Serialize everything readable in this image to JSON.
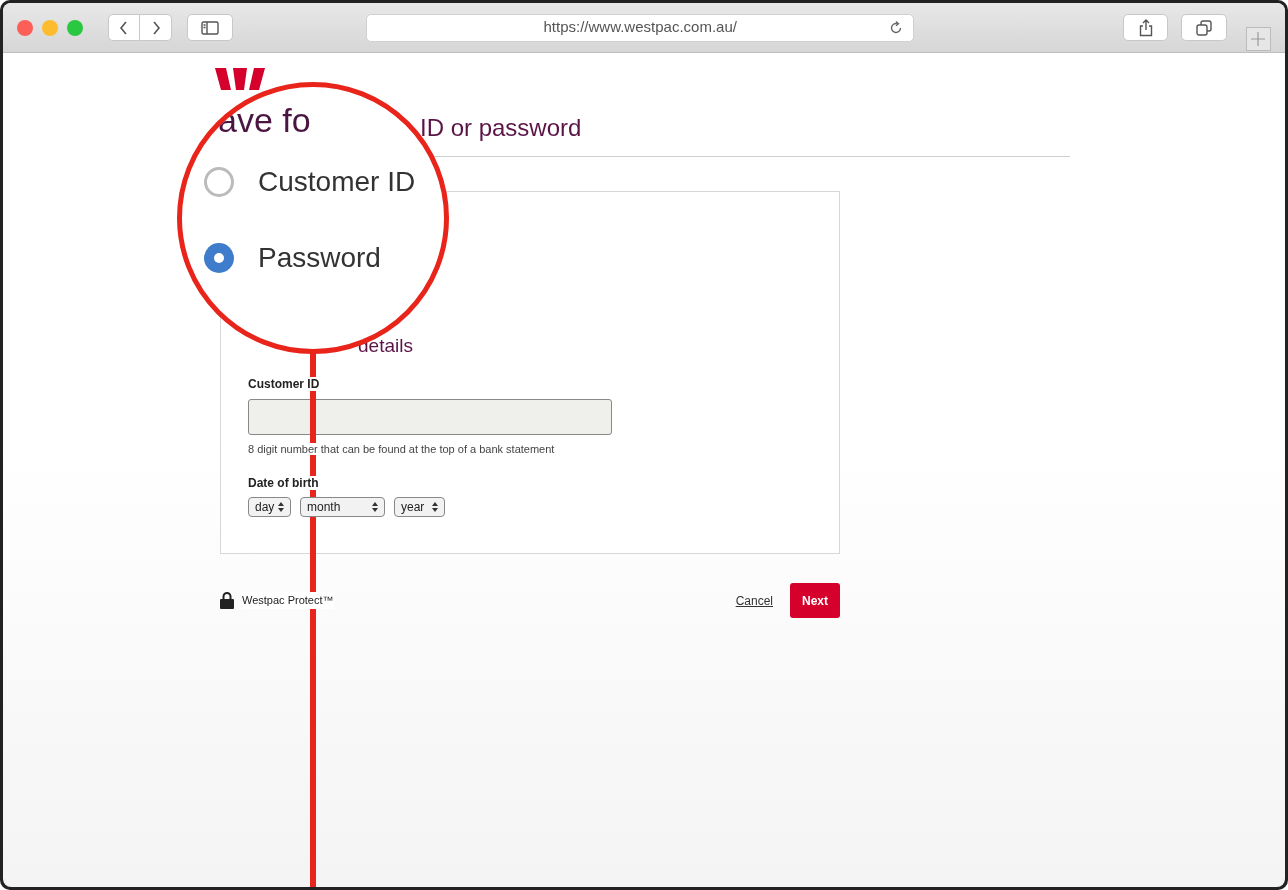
{
  "browser": {
    "url": "https://www.westpac.com.au/"
  },
  "page": {
    "heading": "ID or password",
    "subheading": "details",
    "customer_id": {
      "label": "Customer ID",
      "hint": "8 digit number that can be found at the top of a bank statement"
    },
    "date_of_birth": {
      "label": "Date of birth",
      "selects": [
        {
          "value": "day"
        },
        {
          "value": "month"
        },
        {
          "value": "year"
        }
      ]
    },
    "footer": {
      "protect": "Westpac Protect™",
      "cancel": "Cancel",
      "next": "Next"
    }
  },
  "magnifier": {
    "heading_fragment": "ave fo",
    "options": [
      {
        "label": "Customer ID",
        "selected": false
      },
      {
        "label": "Password",
        "selected": true
      }
    ]
  }
}
